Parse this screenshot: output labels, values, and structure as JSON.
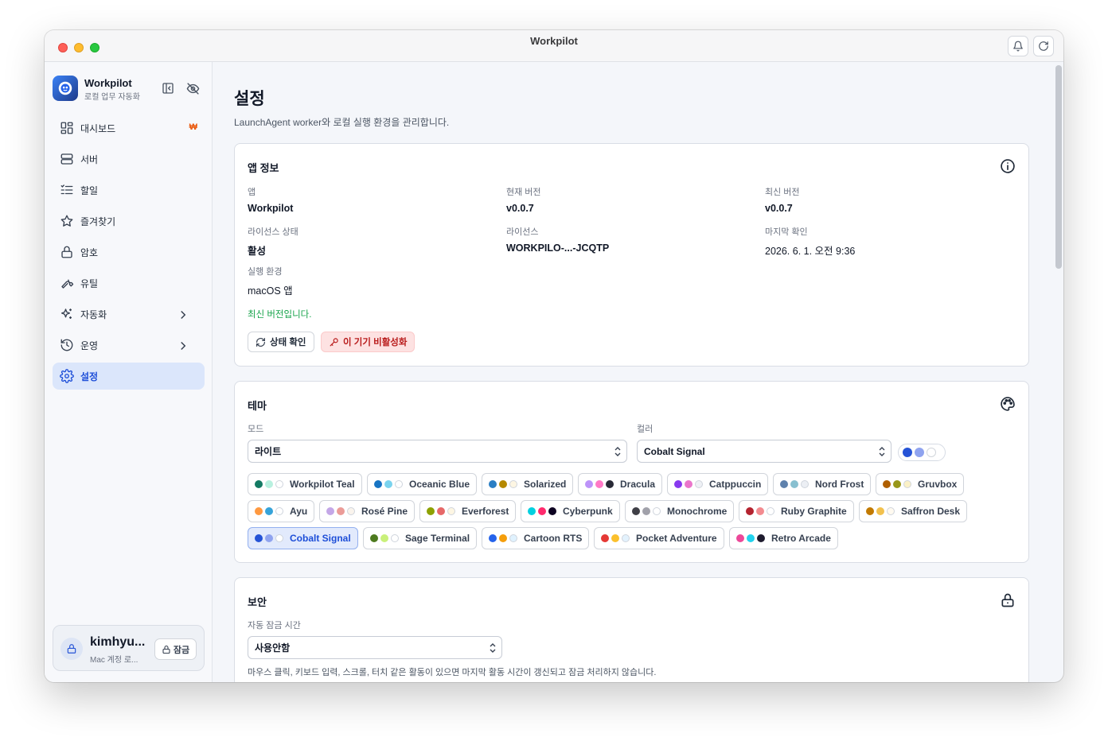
{
  "window": {
    "title": "Workpilot"
  },
  "sidebar": {
    "brand": {
      "name": "Workpilot",
      "subtitle": "로컬 업무 자동화"
    },
    "items": [
      {
        "label": "대시보드",
        "icon": "dashboard-icon",
        "badge": "₩"
      },
      {
        "label": "서버",
        "icon": "server-icon"
      },
      {
        "label": "할일",
        "icon": "list-icon"
      },
      {
        "label": "즐겨찾기",
        "icon": "star-icon"
      },
      {
        "label": "암호",
        "icon": "lock-icon"
      },
      {
        "label": "유틸",
        "icon": "wrench-icon"
      },
      {
        "label": "자동화",
        "icon": "sparkles-icon",
        "has_children": true
      },
      {
        "label": "운영",
        "icon": "history-icon",
        "has_children": true
      },
      {
        "label": "설정",
        "icon": "gear-icon",
        "active": true
      }
    ],
    "user": {
      "name": "kimhyu...",
      "subtitle": "Mac 계정 로...",
      "lock_label": "잠금"
    }
  },
  "page": {
    "title": "설정",
    "subtitle": "LaunchAgent worker와 로컬 실행 환경을 관리합니다."
  },
  "app_info": {
    "title": "앱 정보",
    "fields": {
      "app_label": "앱",
      "app_value": "Workpilot",
      "current_version_label": "현재 버전",
      "current_version_value": "v0.0.7",
      "latest_version_label": "최신 버전",
      "latest_version_value": "v0.0.7",
      "license_status_label": "라이선스 상태",
      "license_status_value": "활성",
      "license_label": "라이선스",
      "license_value": "WORKPILO-...-JCQTP",
      "last_check_label": "마지막 확인",
      "last_check_value": "2026. 6. 1. 오전 9:36",
      "env_label": "실행 환경",
      "env_value": "macOS 앱"
    },
    "status_message": "최신 버전입니다.",
    "check_button": "상태 확인",
    "deactivate_button": "이 기기 비활성화"
  },
  "theme": {
    "title": "테마",
    "mode_label": "모드",
    "mode_value": "라이트",
    "color_label": "컬러",
    "color_value": "Cobalt Signal",
    "preview_colors": [
      "#2553d6",
      "#8fa3ef",
      "#ffffff"
    ],
    "themes": [
      {
        "name": "Workpilot Teal",
        "colors": [
          "#137a63",
          "#b8f0df",
          "#ffffff"
        ]
      },
      {
        "name": "Oceanic Blue",
        "colors": [
          "#1774c3",
          "#7ad3ee",
          "#ffffff"
        ]
      },
      {
        "name": "Solarized",
        "colors": [
          "#2a7ec4",
          "#b58900",
          "#fdf6e3"
        ]
      },
      {
        "name": "Dracula",
        "colors": [
          "#bd93f9",
          "#ff79c6",
          "#282a36"
        ]
      },
      {
        "name": "Catppuccin",
        "colors": [
          "#8839ef",
          "#ea76cb",
          "#eff1f5"
        ]
      },
      {
        "name": "Nord Frost",
        "colors": [
          "#5e81ac",
          "#88c0d0",
          "#eceff4"
        ]
      },
      {
        "name": "Gruvbox",
        "colors": [
          "#af5f00",
          "#98971a",
          "#fbf1c7"
        ]
      },
      {
        "name": "Ayu",
        "colors": [
          "#ff9940",
          "#36a3d9",
          "#ffffff"
        ]
      },
      {
        "name": "Rosé Pine",
        "colors": [
          "#c4a7e7",
          "#eb9c98",
          "#faf4ed"
        ]
      },
      {
        "name": "Everforest",
        "colors": [
          "#8da101",
          "#e66868",
          "#fdf6e3"
        ]
      },
      {
        "name": "Cyberpunk",
        "colors": [
          "#00d0e0",
          "#ff2a6d",
          "#0d0221"
        ]
      },
      {
        "name": "Monochrome",
        "colors": [
          "#3f3f46",
          "#a1a1aa",
          "#ffffff"
        ]
      },
      {
        "name": "Ruby Graphite",
        "colors": [
          "#b4232f",
          "#f38b90",
          "#ffffff"
        ]
      },
      {
        "name": "Saffron Desk",
        "colors": [
          "#c27a00",
          "#f2c14e",
          "#fffaf0"
        ]
      },
      {
        "name": "Cobalt Signal",
        "colors": [
          "#2553d6",
          "#8fa3ef",
          "#ffffff"
        ],
        "selected": true
      },
      {
        "name": "Sage Terminal",
        "colors": [
          "#4d7a1f",
          "#c9f07a",
          "#ffffff"
        ]
      },
      {
        "name": "Cartoon RTS",
        "colors": [
          "#2563eb",
          "#f59e0b",
          "#e0f2fe"
        ]
      },
      {
        "name": "Pocket Adventure",
        "colors": [
          "#e53935",
          "#fbc02d",
          "#e3f2fd"
        ]
      },
      {
        "name": "Retro Arcade",
        "colors": [
          "#ec4899",
          "#22d3ee",
          "#1e1b2e"
        ]
      }
    ]
  },
  "security": {
    "title": "보안",
    "auto_lock_label": "자동 잠금 시간",
    "auto_lock_value": "사용안함",
    "help_text": "마우스 클릭, 키보드 입력, 스크롤, 터치 같은 활동이 있으면 마지막 활동 시간이 갱신되고 잠금 처리하지 않습니다."
  }
}
